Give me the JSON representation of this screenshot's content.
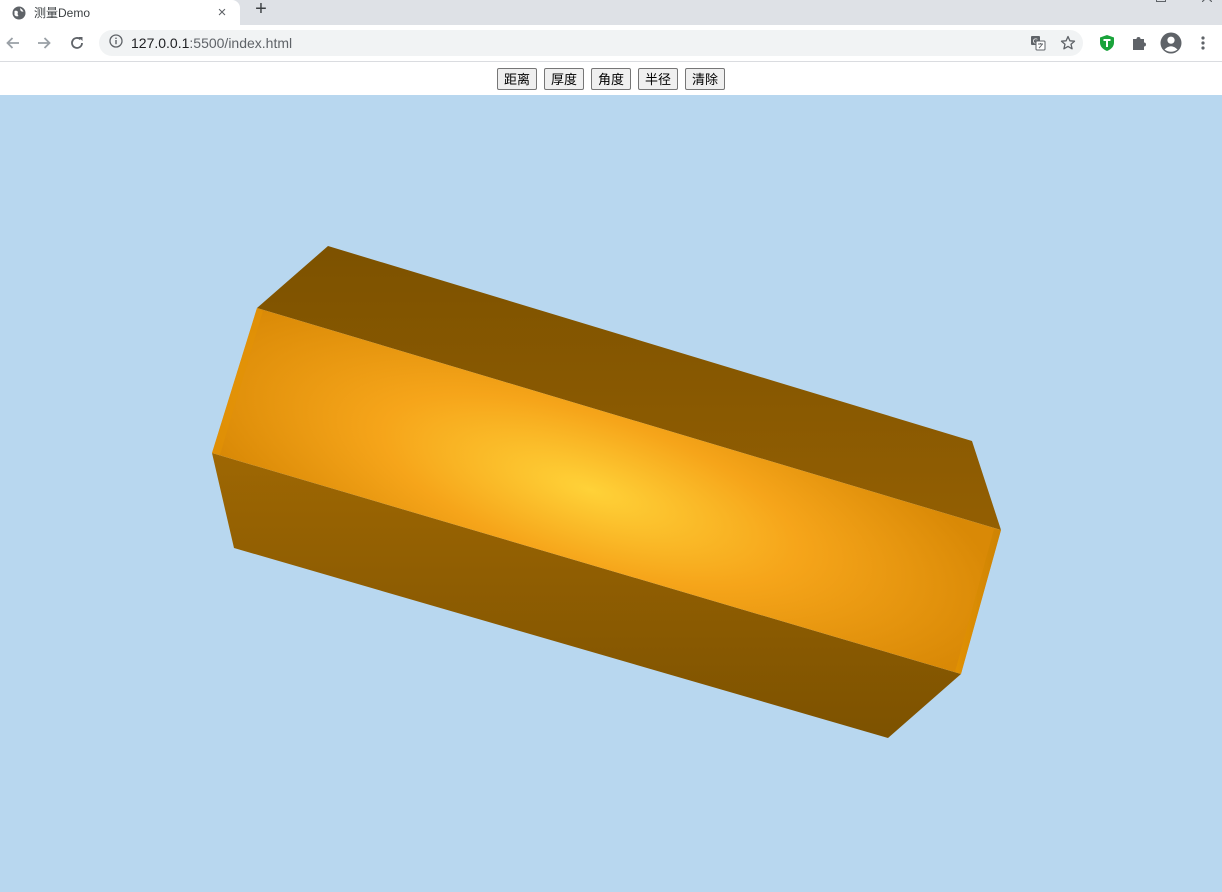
{
  "browser": {
    "tab_title": "测量Demo",
    "tab_close": "×",
    "new_tab": "+",
    "url_host": "127.0.0.1",
    "url_rest": ":5500/index.html",
    "icons": {
      "favicon": "globe-icon",
      "back": "arrow-left-icon",
      "forward": "arrow-right-icon",
      "reload": "reload-icon",
      "site_info": "info-icon",
      "translate": "translate-icon",
      "bookmark": "star-icon",
      "extension_shield": "shield-icon",
      "extensions": "puzzle-icon",
      "profile": "account-icon",
      "menu": "kebab-menu-icon"
    }
  },
  "toolbar": {
    "buttons": [
      {
        "label": "距离"
      },
      {
        "label": "厚度"
      },
      {
        "label": "角度"
      },
      {
        "label": "半径"
      },
      {
        "label": "清除"
      }
    ]
  },
  "scene": {
    "background": "#b8d7ef",
    "object": "hexagonal-prism",
    "colors": {
      "highlight": "#ffd238",
      "mid": "#f6a51a",
      "edge": "#d98906",
      "dark": "#7d5200"
    }
  }
}
